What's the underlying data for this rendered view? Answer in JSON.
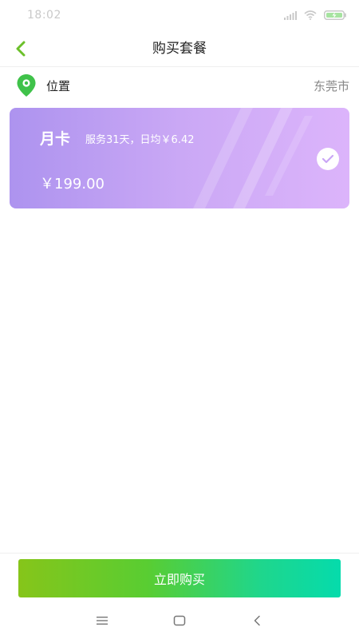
{
  "status_bar": {
    "time": "18:02",
    "icons": [
      "signal-icon",
      "wifi-icon",
      "battery-charging-icon"
    ]
  },
  "nav": {
    "title": "购买套餐",
    "back_icon": "chevron-left-icon"
  },
  "location": {
    "label": "位置",
    "value": "东莞市",
    "icon": "location-pin-icon"
  },
  "plan": {
    "name": "月卡",
    "description": "服务31天，日均￥6.42",
    "price": "￥199.00",
    "selected": true
  },
  "actions": {
    "buy_label": "立即购买"
  },
  "system_nav": {
    "icons": [
      "menu-icon",
      "home-icon",
      "back-icon"
    ]
  },
  "colors": {
    "accent_green": "#6cc02a",
    "pin_green": "#3fc24a",
    "card_start": "#ad93ef",
    "card_end": "#dcb4fb",
    "button_start": "#86c51a",
    "button_end": "#05dbac"
  }
}
